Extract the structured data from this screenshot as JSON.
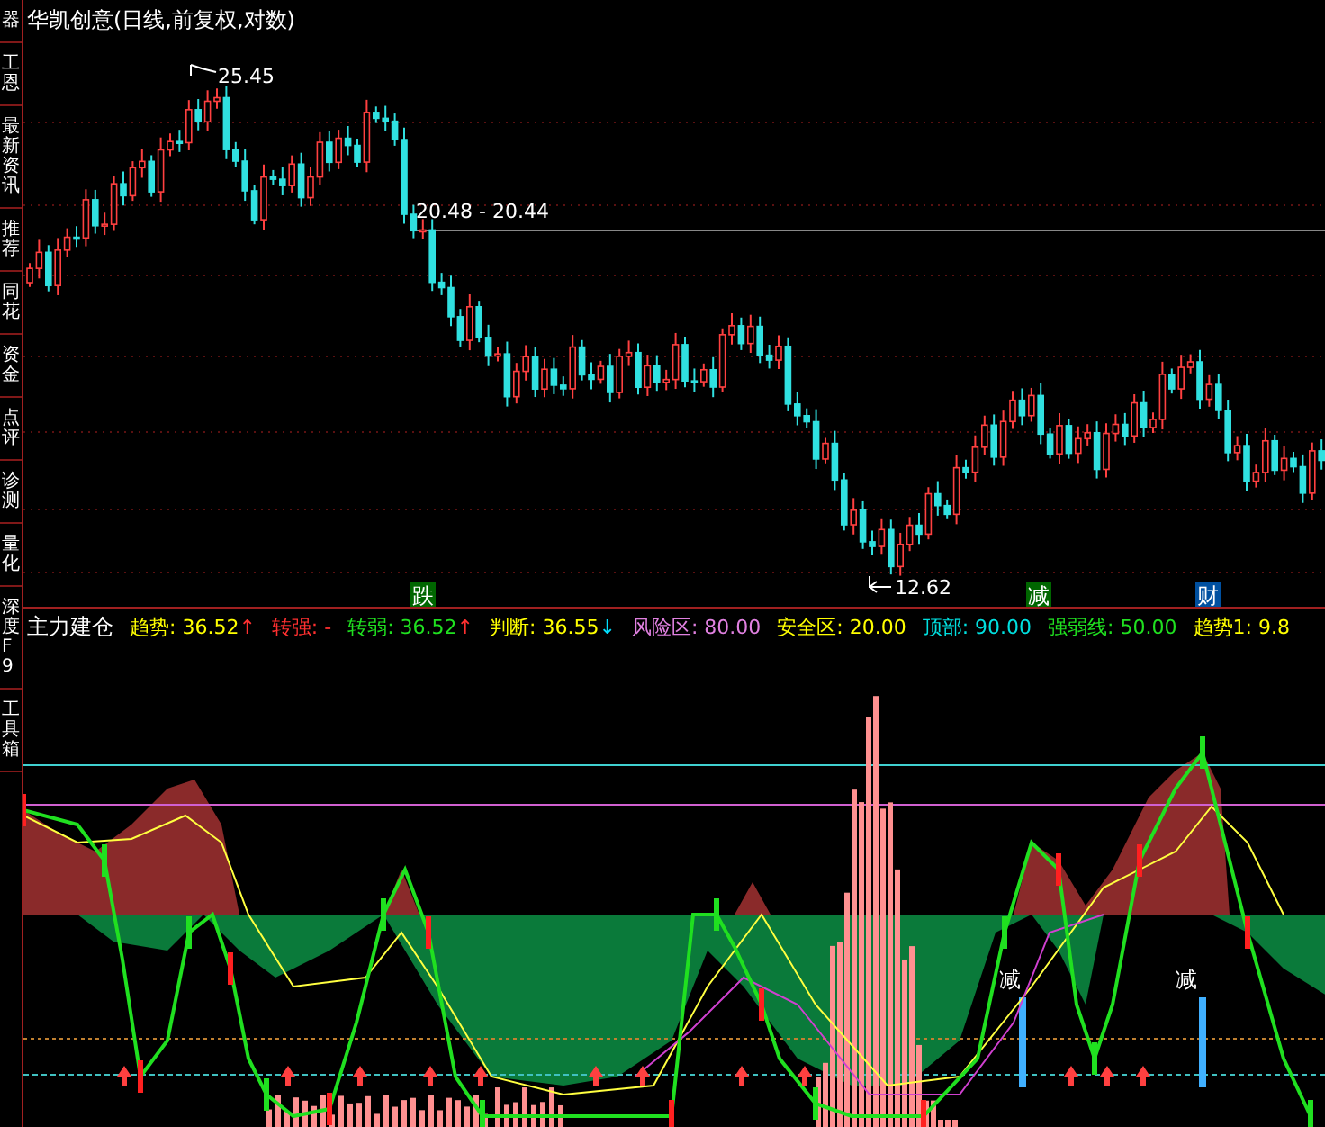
{
  "sidebar": {
    "tabs": [
      {
        "label": "器"
      },
      {
        "label": "工恩"
      },
      {
        "label": "最新资讯"
      },
      {
        "label": "推荐"
      },
      {
        "label": "同花"
      },
      {
        "label": "资金"
      },
      {
        "label": "点评"
      },
      {
        "label": "诊测"
      },
      {
        "label": "量化"
      },
      {
        "label": "深度F9"
      },
      {
        "label": "工具箱"
      }
    ]
  },
  "price_chart": {
    "title": "华凯创意(日线,前复权,对数)",
    "high_label": "25.45",
    "low_label": "12.62",
    "crosshair_label": "20.48 - 20.44",
    "signals": [
      {
        "text": "跌",
        "color": "#006600"
      },
      {
        "text": "减",
        "color": "#006600"
      },
      {
        "text": "财",
        "color": "#0050a0"
      }
    ]
  },
  "indicator": {
    "name": "主力建仓",
    "readouts": [
      {
        "label": "趋势:",
        "value": "36.52",
        "arrow": {
          "text": "↑",
          "color": "#ff3030"
        },
        "color": "#ffff00"
      },
      {
        "label": "转强:",
        "value": "-",
        "color": "#ff3030"
      },
      {
        "label": "转弱:",
        "value": "36.52",
        "arrow": {
          "text": "↑",
          "color": "#ff3030"
        },
        "color": "#20e020"
      },
      {
        "label": "判断:",
        "value": "36.55",
        "arrow": {
          "text": "↓",
          "color": "#00e0ff"
        },
        "color": "#ffff00"
      },
      {
        "label": "风险区:",
        "value": "80.00",
        "color": "#e080e0"
      },
      {
        "label": "安全区:",
        "value": "20.00",
        "color": "#ffff00"
      },
      {
        "label": "顶部:",
        "value": "90.00",
        "color": "#00e0e0"
      },
      {
        "label": "强弱线:",
        "value": "50.00",
        "color": "#20e020"
      },
      {
        "label": "趋势1:",
        "value": "9.8",
        "color": "#ffff00"
      }
    ],
    "signals": [
      {
        "text": "减"
      },
      {
        "text": "减"
      }
    ]
  }
}
